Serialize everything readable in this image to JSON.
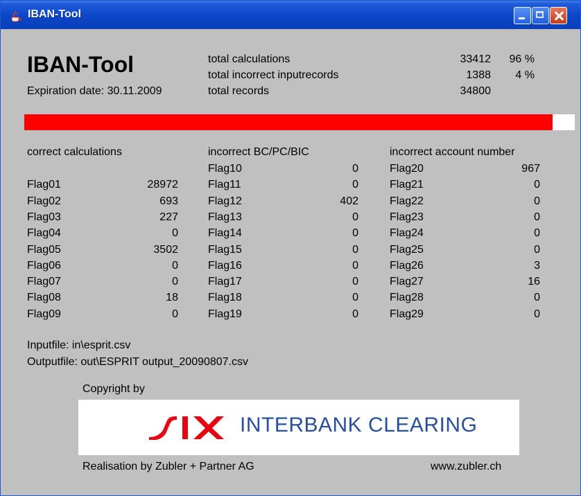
{
  "window": {
    "title": "IBAN-Tool",
    "controls": {
      "minimize": "minimize",
      "maximize": "maximize",
      "close": "close"
    }
  },
  "header": {
    "app_title": "IBAN-Tool",
    "expiration": "Expiration date: 30.11.2009"
  },
  "summary": [
    {
      "label": "total calculations",
      "value": "33412",
      "percent": "96 %"
    },
    {
      "label": "total incorrect inputrecords",
      "value": "1388",
      "percent": "4 %"
    },
    {
      "label": "total records",
      "value": "34800",
      "percent": ""
    }
  ],
  "progress": {
    "fraction": 0.96,
    "fill_color": "#ff0000",
    "track_color": "#ffffff"
  },
  "columns": {
    "correct": {
      "heading": "correct calculations",
      "rows": [
        {
          "flag": "Flag01",
          "value": "28972"
        },
        {
          "flag": "Flag02",
          "value": "693"
        },
        {
          "flag": "Flag03",
          "value": "227"
        },
        {
          "flag": "Flag04",
          "value": "0"
        },
        {
          "flag": "Flag05",
          "value": "3502"
        },
        {
          "flag": "Flag06",
          "value": "0"
        },
        {
          "flag": "Flag07",
          "value": "0"
        },
        {
          "flag": "Flag08",
          "value": "18"
        },
        {
          "flag": "Flag09",
          "value": "0"
        }
      ]
    },
    "bc": {
      "heading": "incorrect BC/PC/BIC",
      "rows": [
        {
          "flag": "Flag10",
          "value": "0"
        },
        {
          "flag": "Flag11",
          "value": "0"
        },
        {
          "flag": "Flag12",
          "value": "402"
        },
        {
          "flag": "Flag13",
          "value": "0"
        },
        {
          "flag": "Flag14",
          "value": "0"
        },
        {
          "flag": "Flag15",
          "value": "0"
        },
        {
          "flag": "Flag16",
          "value": "0"
        },
        {
          "flag": "Flag17",
          "value": "0"
        },
        {
          "flag": "Flag18",
          "value": "0"
        },
        {
          "flag": "Flag19",
          "value": "0"
        }
      ]
    },
    "account": {
      "heading": "incorrect account number",
      "rows": [
        {
          "flag": "Flag20",
          "value": "967"
        },
        {
          "flag": "Flag21",
          "value": "0"
        },
        {
          "flag": "Flag22",
          "value": "0"
        },
        {
          "flag": "Flag23",
          "value": "0"
        },
        {
          "flag": "Flag24",
          "value": "0"
        },
        {
          "flag": "Flag25",
          "value": "0"
        },
        {
          "flag": "Flag26",
          "value": "3"
        },
        {
          "flag": "Flag27",
          "value": "16"
        },
        {
          "flag": "Flag28",
          "value": "0"
        },
        {
          "flag": "Flag29",
          "value": "0"
        }
      ]
    }
  },
  "files": {
    "input": "Inputfile:   in\\esprit.csv",
    "output": "Outputfile: out\\ESPRIT output_20090807.csv"
  },
  "footer": {
    "copyright": "Copyright by",
    "logo_text": "INTERBANK CLEARING",
    "logo_icon": "six-logo",
    "brand_color": "#e30613",
    "realisation": "Realisation by Zubler + Partner AG",
    "website": "www.zubler.ch"
  }
}
